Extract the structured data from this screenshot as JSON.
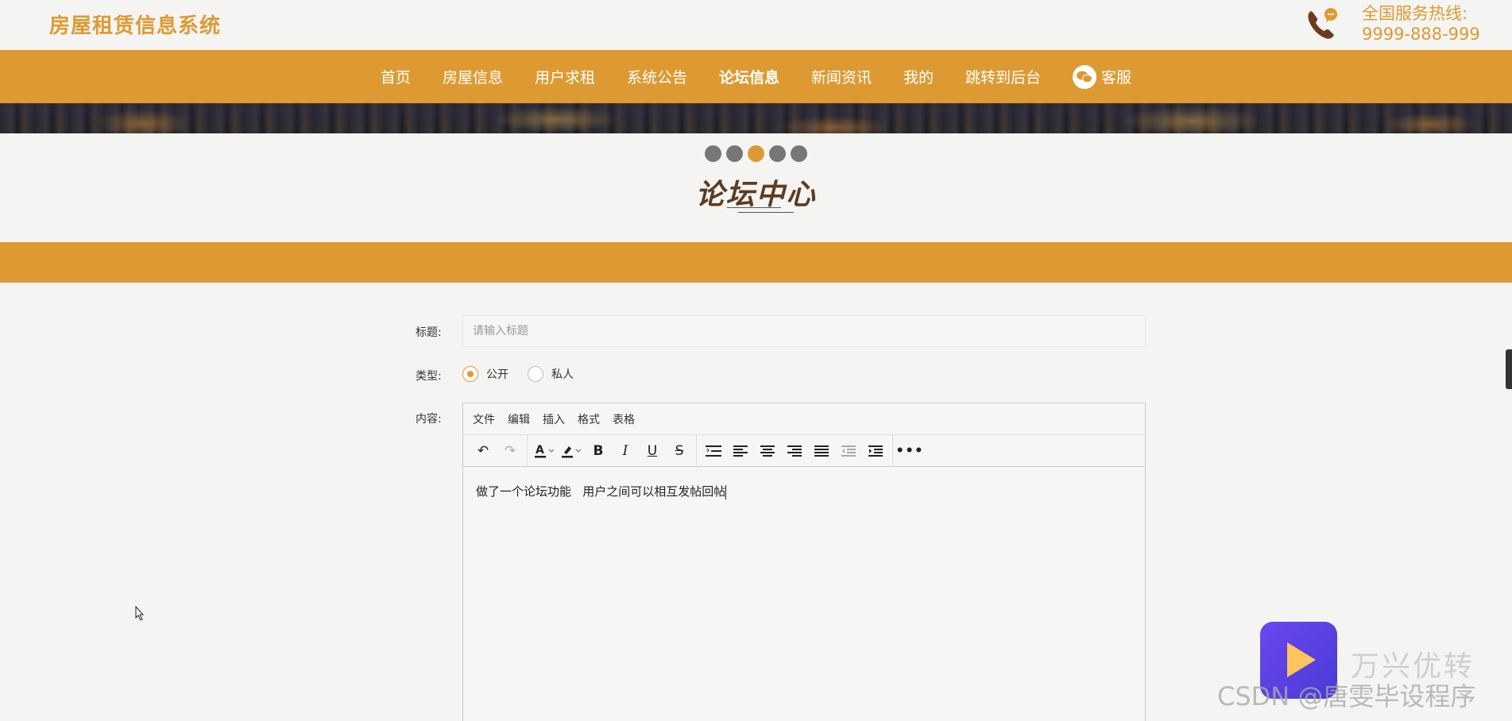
{
  "header": {
    "site_title": "房屋租赁信息系统",
    "hotline_label": "全国服务热线:",
    "hotline_number": "9999-888-999",
    "phone_icon": "phone-icon"
  },
  "nav": {
    "items": [
      {
        "label": "首页"
      },
      {
        "label": "房屋信息"
      },
      {
        "label": "用户求租"
      },
      {
        "label": "系统公告"
      },
      {
        "label": "论坛信息"
      },
      {
        "label": "新闻资讯"
      },
      {
        "label": "我的"
      },
      {
        "label": "跳转到后台"
      }
    ],
    "service_label": "客服",
    "service_icon": "wechat-icon",
    "active_index": 4
  },
  "section": {
    "title": "论坛中心",
    "dots_active": 2
  },
  "form": {
    "title_label": "标题:",
    "title_placeholder": "请输入标题",
    "type_label": "类型:",
    "type_options": [
      {
        "label": "公开",
        "checked": true
      },
      {
        "label": "私人",
        "checked": false
      }
    ],
    "content_label": "内容:",
    "editor_menu": [
      "文件",
      "编辑",
      "插入",
      "格式",
      "表格"
    ],
    "editor_content": "做了一个论坛功能   用户之间可以相互发帖回帖"
  },
  "watermark": {
    "brand": "万兴优转",
    "csdn": "CSDN @唐雯毕设程序"
  },
  "colors": {
    "accent": "#dd9a33",
    "title_brown": "#5b3c22"
  }
}
